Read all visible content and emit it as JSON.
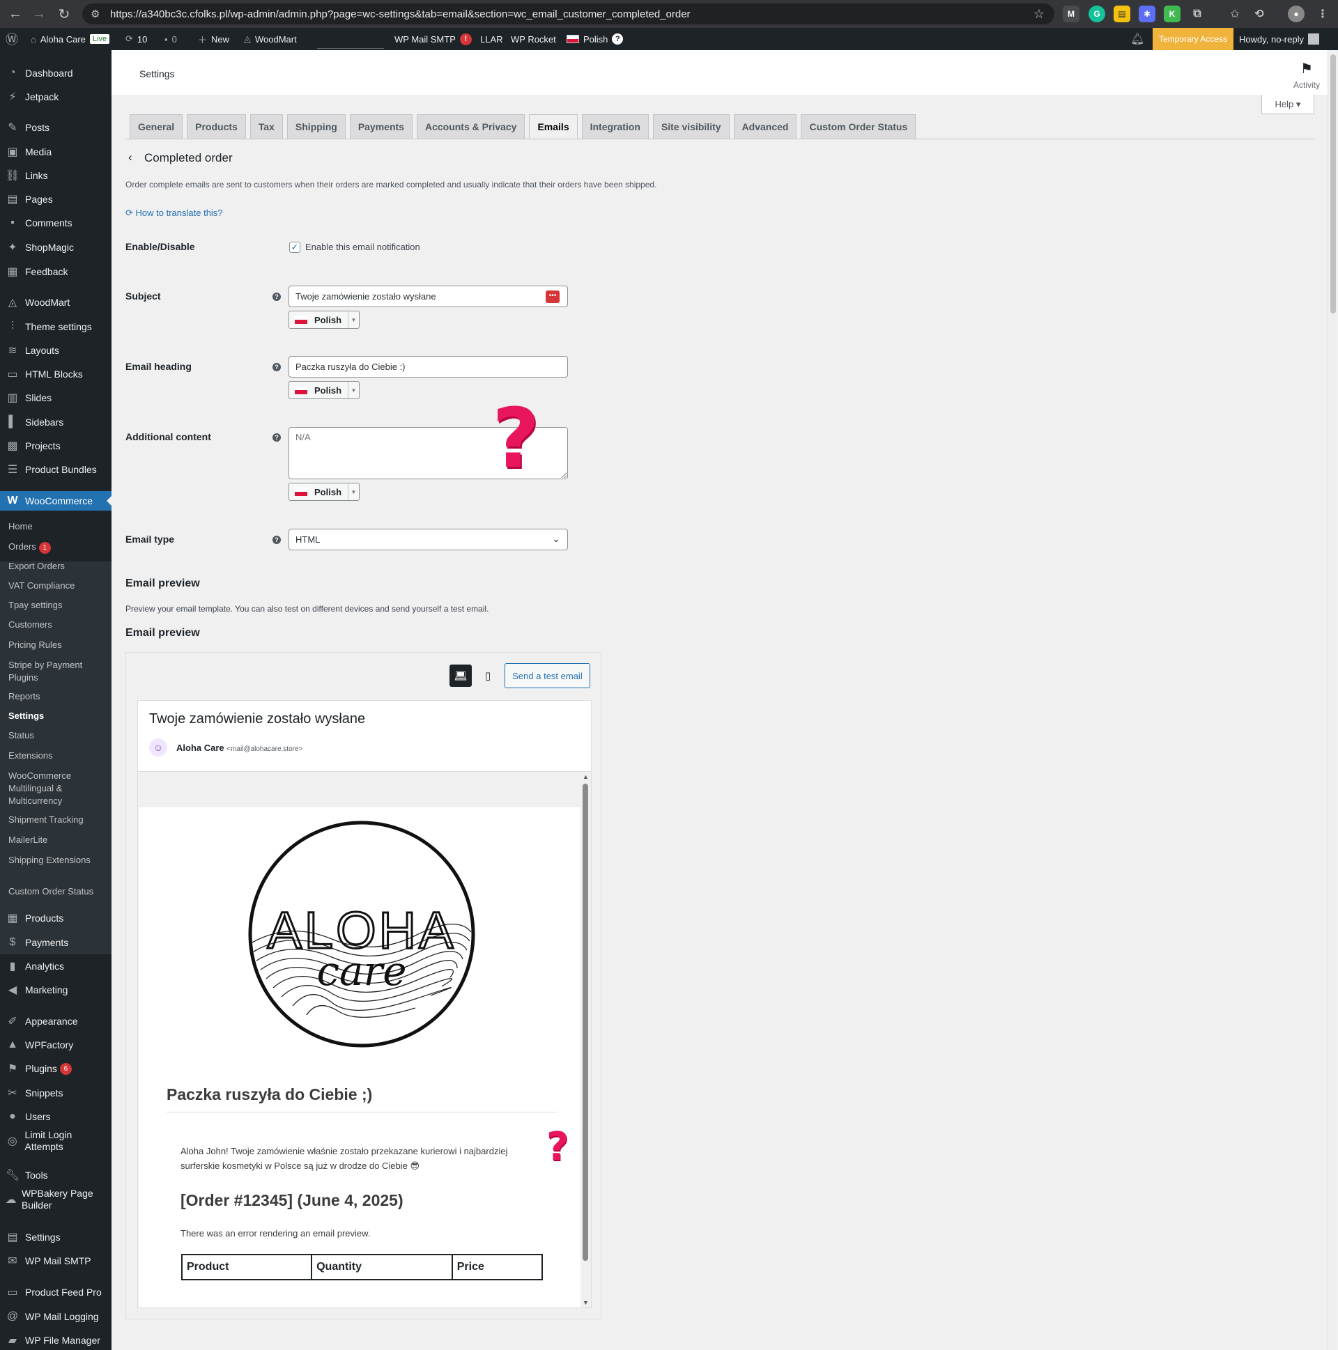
{
  "browser": {
    "url": "https://a340bc3c.cfolks.pl/wp-admin/admin.php?page=wc-settings&tab=email&section=wc_email_customer_completed_order"
  },
  "adminbar": {
    "site_name": "Aloha Care",
    "live_badge": "Live",
    "updates_count": "10",
    "comments_count": "0",
    "new_label": "New",
    "woodmart_label": "WoodMart",
    "wp_mail_smtp_label": "WP Mail SMTP",
    "wp_mail_smtp_alert": "!",
    "llar_label": "LLAR",
    "wp_rocket_label": "WP Rocket",
    "language_label": "Polish",
    "temporary_access_label": "Temporary Access",
    "howdy_label": "Howdy, no-reply"
  },
  "sidebar": {
    "items": [
      {
        "label": "Dashboard",
        "icon": "dashboard-icon"
      },
      {
        "label": "Jetpack",
        "icon": "jetpack-icon"
      },
      {
        "label": "Posts",
        "icon": "pin-icon"
      },
      {
        "label": "Media",
        "icon": "media-icon"
      },
      {
        "label": "Links",
        "icon": "link-icon"
      },
      {
        "label": "Pages",
        "icon": "pages-icon"
      },
      {
        "label": "Comments",
        "icon": "comment-icon"
      },
      {
        "label": "ShopMagic",
        "icon": "wand-icon"
      },
      {
        "label": "Feedback",
        "icon": "feedback-icon"
      },
      {
        "label": "WoodMart",
        "icon": "woodmart-icon"
      },
      {
        "label": "Theme settings",
        "icon": "sliders-icon"
      },
      {
        "label": "Layouts",
        "icon": "layers-icon"
      },
      {
        "label": "HTML Blocks",
        "icon": "blocks-icon"
      },
      {
        "label": "Slides",
        "icon": "slides-icon"
      },
      {
        "label": "Sidebars",
        "icon": "sidebar-icon"
      },
      {
        "label": "Projects",
        "icon": "briefcase-icon"
      },
      {
        "label": "Product Bundles",
        "icon": "stack-icon"
      },
      {
        "label": "WooCommerce",
        "icon": "woo-icon"
      },
      {
        "label": "Products",
        "icon": "archive-icon"
      },
      {
        "label": "Payments",
        "icon": "dollar-icon"
      },
      {
        "label": "Analytics",
        "icon": "bar-chart-icon"
      },
      {
        "label": "Marketing",
        "icon": "megaphone-icon"
      },
      {
        "label": "Appearance",
        "icon": "brush-icon"
      },
      {
        "label": "WPFactory",
        "icon": "factory-icon"
      },
      {
        "label": "Plugins",
        "icon": "plug-icon",
        "badge": "6"
      },
      {
        "label": "Snippets",
        "icon": "scissors-icon"
      },
      {
        "label": "Users",
        "icon": "user-icon"
      },
      {
        "label": "Limit Login Attempts",
        "icon": "shield-icon"
      },
      {
        "label": "Tools",
        "icon": "wrench-icon"
      },
      {
        "label": "WPBakery Page Builder",
        "icon": "cloud-icon"
      },
      {
        "label": "Settings",
        "icon": "settings-icon"
      },
      {
        "label": "WP Mail SMTP",
        "icon": "mail-icon"
      },
      {
        "label": "Product Feed Pro",
        "icon": "feed-icon"
      },
      {
        "label": "WP Mail Logging",
        "icon": "at-icon"
      },
      {
        "label": "WP File Manager",
        "icon": "folder-icon"
      }
    ],
    "woo_submenu": [
      {
        "label": "Home"
      },
      {
        "label": "Orders",
        "badge": "1"
      },
      {
        "label": "Export Orders"
      },
      {
        "label": "VAT Compliance"
      },
      {
        "label": "Tpay settings"
      },
      {
        "label": "Customers"
      },
      {
        "label": "Pricing Rules"
      },
      {
        "label": "Stripe by Payment Plugins"
      },
      {
        "label": "Reports"
      },
      {
        "label": "Settings"
      },
      {
        "label": "Status"
      },
      {
        "label": "Extensions"
      },
      {
        "label": "WooCommerce Multilingual & Multicurrency"
      },
      {
        "label": "Shipment Tracking"
      },
      {
        "label": "MailerLite"
      },
      {
        "label": "Shipping Extensions"
      },
      {
        "label": "Custom Order Status"
      }
    ]
  },
  "header": {
    "title": "Settings",
    "activity_label": "Activity",
    "help_label": "Help"
  },
  "tabs": [
    "General",
    "Products",
    "Tax",
    "Shipping",
    "Payments",
    "Accounts & Privacy",
    "Emails",
    "Integration",
    "Site visibility",
    "Advanced",
    "Custom Order Status"
  ],
  "active_tab": "Emails",
  "section": {
    "title": "Completed order",
    "description": "Order complete emails are sent to customers when their orders are marked completed and usually indicate that their orders have been shipped.",
    "translate_link": "How to translate this?"
  },
  "form": {
    "enable_label": "Enable/Disable",
    "enable_checkbox_label": "Enable this email notification",
    "enabled": true,
    "subject_label": "Subject",
    "subject_value": "Twoje zamówienie zostało wysłane",
    "heading_label": "Email heading",
    "heading_value": "Paczka ruszyła do Ciebie :)",
    "additional_label": "Additional content",
    "additional_placeholder": "N/A",
    "language": "Polish",
    "email_type_label": "Email type",
    "email_type_value": "HTML"
  },
  "preview": {
    "section_heading": "Email preview",
    "section_description": "Preview your email template. You can also test on different devices and send yourself a test email.",
    "sub_heading": "Email preview",
    "send_test_label": "Send a test email",
    "email_subject": "Twoje zamówienie zostało wysłane",
    "sender_name": "Aloha Care",
    "sender_email": "<mail@alohacare.store>",
    "logo_word1": "ALOHA",
    "logo_word2": "care",
    "email_heading": "Paczka ruszyła do Ciebie ;)",
    "intro_text": "Aloha John! Twoje zamówienie właśnie zostało przekazane kurierowi i najbardziej surferskie kosmetyki w Polsce są już w drodze do Ciebie 😎",
    "order_title": "[Order #12345] (June 4, 2025)",
    "error_text": "There was an error rendering an email preview.",
    "table_headers": [
      "Product",
      "Quantity",
      "Price"
    ]
  },
  "colors": {
    "admin_dark": "#1d2327",
    "accent_blue": "#2271b1",
    "temporary_access": "#f0b33b",
    "question_mark": "#e8175d"
  }
}
